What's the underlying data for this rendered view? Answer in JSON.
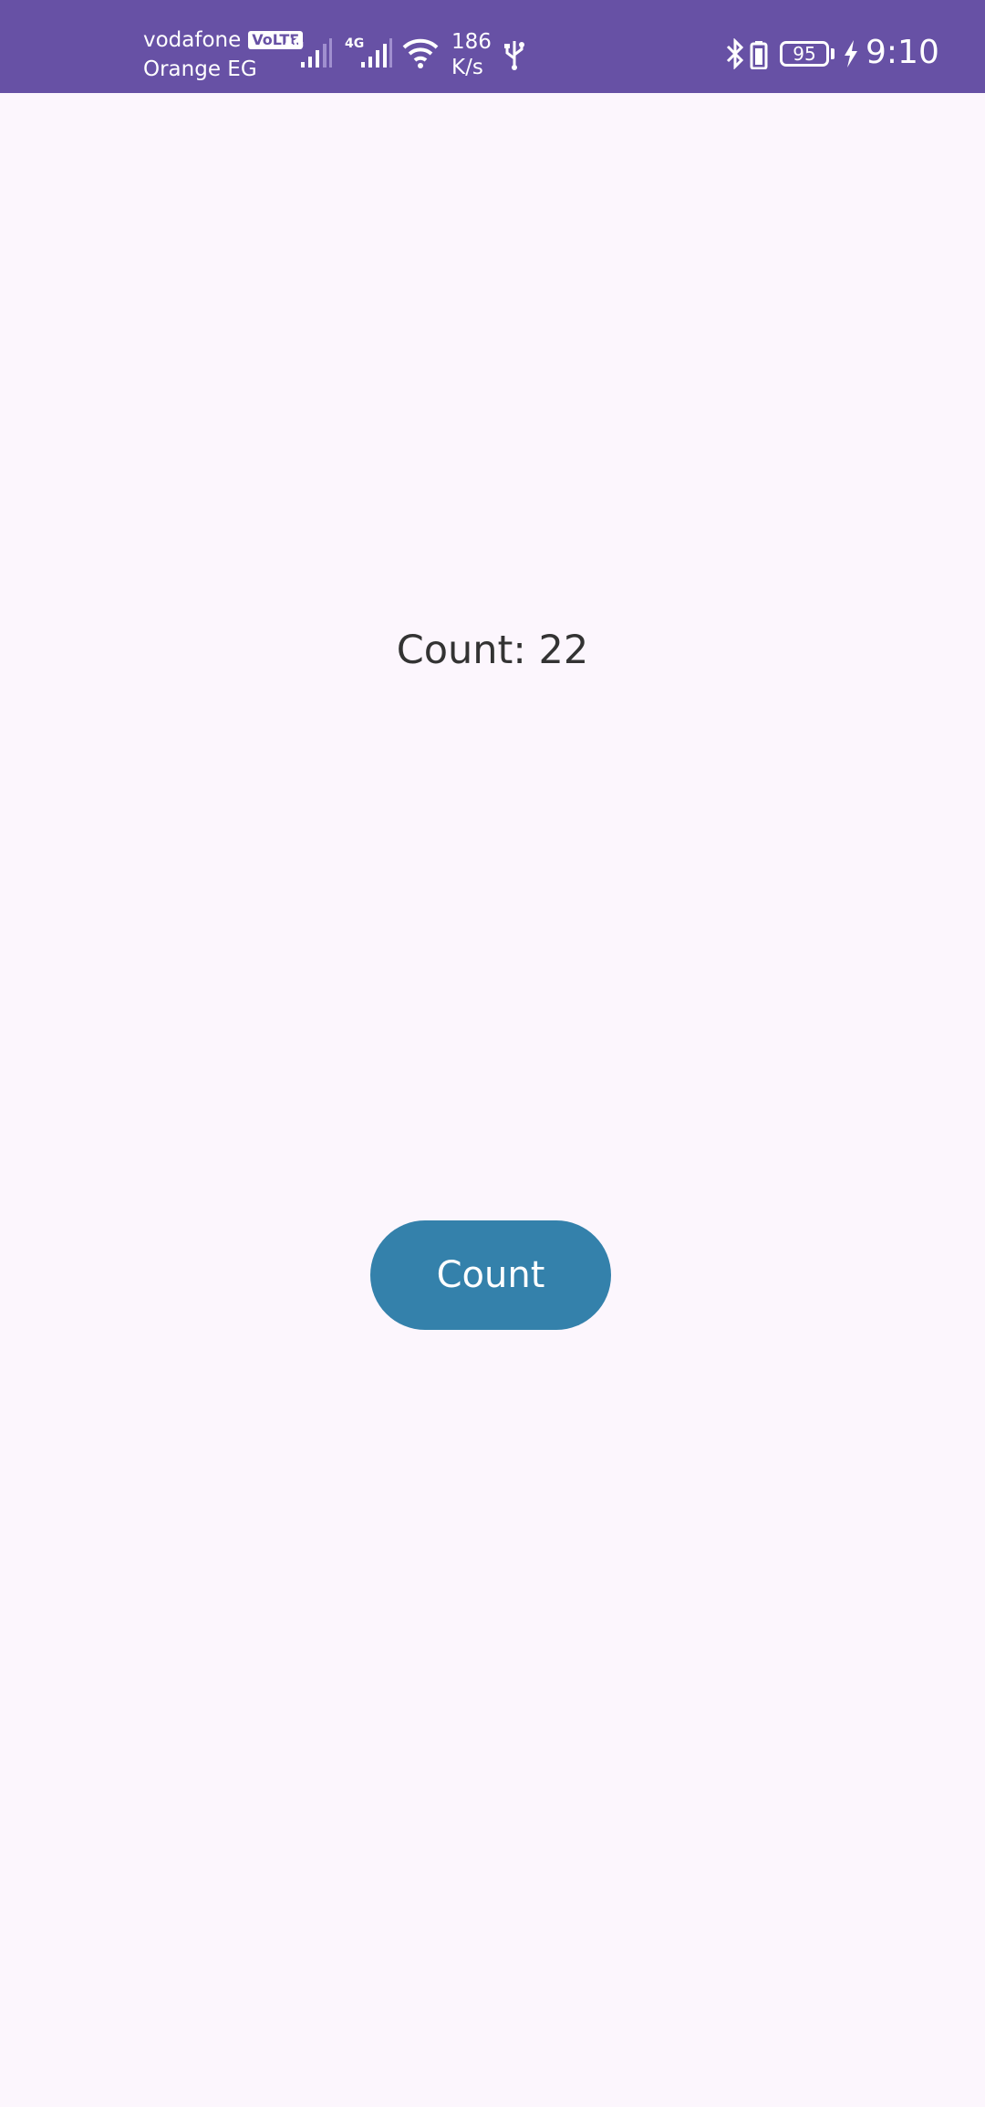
{
  "status_bar": {
    "carrier1": "vodafone",
    "volte": "VoLTE",
    "carrier2": "Orange EG",
    "net1": "4G",
    "net2": "4G",
    "speed_value": "186",
    "speed_unit": "K/s",
    "battery_level": "95",
    "time": "9:10",
    "icons": [
      "signal-icon",
      "wifi-icon",
      "usb-icon",
      "bluetooth-icon",
      "battery-saver-icon",
      "battery-icon",
      "charging-icon"
    ],
    "background_color": "#6751a5"
  },
  "main": {
    "count_label": "Count: 22",
    "button_label": "Count",
    "button_color": "#3481ab",
    "background_color": "#fcf6fd"
  }
}
